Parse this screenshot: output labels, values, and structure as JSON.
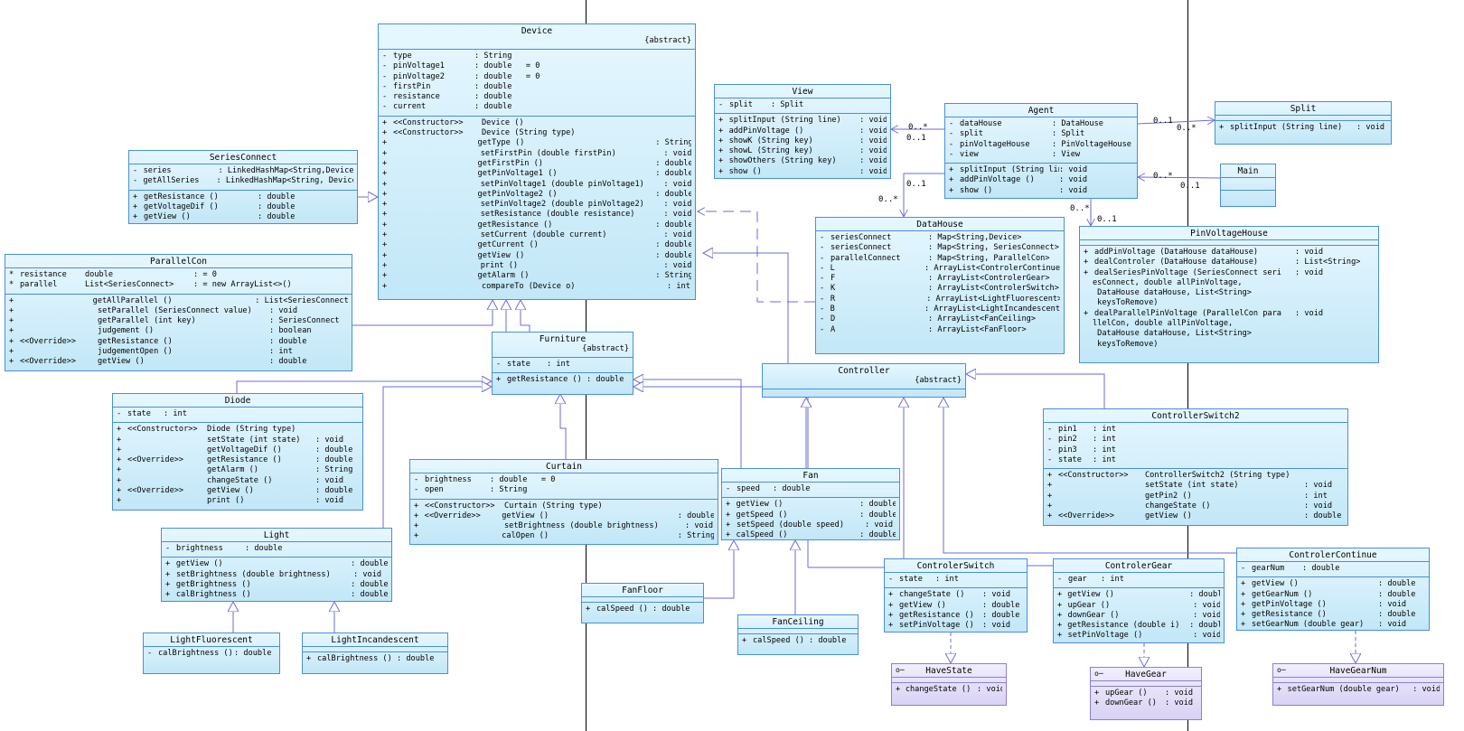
{
  "multiplicities": [
    "0..*",
    "0..1",
    "0..1",
    "0..*",
    "0..1",
    "0..*",
    "0..*",
    "0..1",
    "0..*",
    "0..1"
  ],
  "classes": {
    "device": {
      "name": "Device",
      "stereotype": "{abstract}",
      "attrs": [
        [
          "-",
          "type",
          "",
          "String"
        ],
        [
          "-",
          "pinVoltage1",
          "",
          "double   = 0"
        ],
        [
          "-",
          "pinVoltage2",
          "",
          "double   = 0"
        ],
        [
          "-",
          "firstPin",
          "",
          "double"
        ],
        [
          "-",
          "resistance",
          "",
          "double"
        ],
        [
          "-",
          "current",
          "",
          "double"
        ]
      ],
      "ops": [
        [
          "+",
          "<<Constructor>>",
          "Device ()",
          ""
        ],
        [
          "+",
          "<<Constructor>>",
          "Device (String type)",
          ""
        ],
        [
          "+",
          "",
          "getType ()",
          "String"
        ],
        [
          "+",
          "",
          "setFirstPin (double firstPin)",
          "void"
        ],
        [
          "+",
          "",
          "getFirstPin ()",
          "double"
        ],
        [
          "+",
          "",
          "getPinVoltage1 ()",
          "double"
        ],
        [
          "+",
          "",
          "setPinVoltage1 (double pinVoltage1)",
          "void"
        ],
        [
          "+",
          "",
          "getPinVoltage2 ()",
          "double"
        ],
        [
          "+",
          "",
          "setPinVoltage2 (double pinVoltage2)",
          "void"
        ],
        [
          "+",
          "",
          "setResistance (double resistance)",
          "void"
        ],
        [
          "+",
          "",
          "getResistance ()",
          "double"
        ],
        [
          "+",
          "",
          "setCurrent (double current)",
          "void"
        ],
        [
          "+",
          "",
          "getCurrent ()",
          "double"
        ],
        [
          "+",
          "",
          "getView ()",
          "double"
        ],
        [
          "+",
          "",
          "print ()",
          "void"
        ],
        [
          "+",
          "",
          "getAlarm ()",
          "String"
        ],
        [
          "+",
          "",
          "compareTo (Device o)",
          "int"
        ]
      ]
    },
    "seriesConnect": {
      "name": "SeriesConnect",
      "attrs": [
        [
          "-",
          "series",
          "",
          "LinkedHashMap<String,Device>"
        ],
        [
          "-",
          "getAllSeries",
          "",
          "LinkedHashMap<String, Device>"
        ]
      ],
      "ops": [
        [
          "+",
          "",
          "getResistance ()",
          "double"
        ],
        [
          "+",
          "",
          "getVoltageDif ()",
          "double"
        ],
        [
          "+",
          "",
          "getView ()",
          "double"
        ]
      ]
    },
    "parallelCon": {
      "name": "ParallelCon",
      "attrs": [
        [
          "*",
          "resistance",
          "double",
          "= 0"
        ],
        [
          "*",
          "parallel",
          "List<SeriesConnect>",
          "= new ArrayList<>()"
        ]
      ],
      "ops": [
        [
          "+",
          "",
          "getAllParallel ()",
          "List<SeriesConnect>"
        ],
        [
          "+",
          "",
          "setParallel (SeriesConnect value)",
          "void"
        ],
        [
          "+",
          "",
          "getParallel (int key)",
          "SeriesConnect"
        ],
        [
          "+",
          "",
          "judgement ()",
          "boolean"
        ],
        [
          "+",
          "<<Override>>",
          "getResistance ()",
          "double"
        ],
        [
          "+",
          "",
          "judgementOpen ()",
          "int"
        ],
        [
          "+",
          "<<Override>>",
          "getView ()",
          "double"
        ]
      ]
    },
    "view": {
      "name": "View",
      "attrs": [
        [
          "-",
          "split",
          "",
          "Split"
        ]
      ],
      "ops": [
        [
          "+",
          "",
          "splitInput (String line)",
          "void"
        ],
        [
          "+",
          "",
          "addPinVoltage ()",
          "void"
        ],
        [
          "+",
          "",
          "showK (String key)",
          "void"
        ],
        [
          "+",
          "",
          "showL (String key)",
          "void"
        ],
        [
          "+",
          "",
          "showOthers (String key)",
          "void"
        ],
        [
          "+",
          "",
          "show ()",
          "void"
        ]
      ]
    },
    "agent": {
      "name": "Agent",
      "attrs": [
        [
          "-",
          "dataHouse",
          "",
          "DataHouse"
        ],
        [
          "-",
          "split",
          "",
          "Split"
        ],
        [
          "-",
          "pinVoltageHouse",
          "",
          "PinVoltageHouse"
        ],
        [
          "-",
          "view",
          "",
          "View"
        ]
      ],
      "ops": [
        [
          "+",
          "",
          "splitInput (String line)",
          "void"
        ],
        [
          "+",
          "",
          "addPinVoltage ()",
          "void"
        ],
        [
          "+",
          "",
          "show ()",
          "void"
        ]
      ]
    },
    "split": {
      "name": "Split",
      "attrs": [],
      "ops": [
        [
          "+",
          "",
          "splitInput (String line)",
          "void"
        ]
      ]
    },
    "main": {
      "name": "Main"
    },
    "dataHouse": {
      "name": "DataHouse",
      "attrs": [
        [
          "-",
          "seriesConnect",
          "",
          "Map<String,Device>"
        ],
        [
          "-",
          "seriesConnect",
          "",
          "Map<String, SeriesConnect>"
        ],
        [
          "-",
          "parallelConnect",
          "",
          "Map<String, ParallelCon>"
        ],
        [
          "-",
          "L",
          "",
          "ArrayList<ControlerContinue>"
        ],
        [
          "-",
          "F",
          "",
          "ArrayList<ControlerGear>"
        ],
        [
          "-",
          "K",
          "",
          "ArrayList<ControlerSwitch>"
        ],
        [
          "-",
          "R",
          "",
          "ArrayList<LightFluorescent>"
        ],
        [
          "-",
          "B",
          "",
          "ArrayList<LightIncandescent>"
        ],
        [
          "-",
          "D",
          "",
          "ArrayList<FanCeiling>"
        ],
        [
          "-",
          "A",
          "",
          "ArrayList<FanFloor>"
        ]
      ]
    },
    "pinVoltageHouse": {
      "name": "PinVoltageHouse",
      "ops": [
        [
          "+",
          "addPinVoltage (DataHouse dataHouse)",
          "void"
        ],
        [
          "+",
          "dealControler (DataHouse dataHouse)",
          "List<String>"
        ],
        [
          "+",
          "dealSeriesPinVoltage (SeriesConnect seri",
          "void"
        ],
        [
          "+",
          "dealParallelPinVoltage (ParallelCon para",
          "void"
        ]
      ],
      "wrap1": [
        "esConnect, double allPinVoltage,",
        " DataHouse dataHouse, List<String>",
        " keysToRemove)"
      ],
      "wrap2": [
        "llelCon, double allPinVoltage,",
        " DataHouse dataHouse, List<String>",
        " keysToRemove)"
      ]
    },
    "furniture": {
      "name": "Furniture",
      "stereotype": "{abstract}",
      "attrs": [
        [
          "-",
          "state",
          "",
          "int"
        ]
      ],
      "ops": [
        [
          "+",
          "",
          "getResistance ()",
          "double"
        ]
      ]
    },
    "controller": {
      "name": "Controller",
      "stereotype": "{abstract}"
    },
    "controllerSwitch2": {
      "name": "ControllerSwitch2",
      "attrs": [
        [
          "-",
          "pin1",
          "",
          "int"
        ],
        [
          "-",
          "pin2",
          "",
          "int"
        ],
        [
          "-",
          "pin3",
          "",
          "int"
        ],
        [
          "-",
          "state",
          "",
          "int"
        ]
      ],
      "ops": [
        [
          "+",
          "<<Constructor>>",
          "ControllerSwitch2 (String type)",
          ""
        ],
        [
          "+",
          "",
          "setState (int state)",
          "void"
        ],
        [
          "+",
          "",
          "getPin2 ()",
          "int"
        ],
        [
          "+",
          "",
          "changeState ()",
          "void"
        ],
        [
          "+",
          "<<Override>>",
          "getView ()",
          "double"
        ]
      ]
    },
    "diode": {
      "name": "Diode",
      "attrs": [
        [
          "-",
          "state",
          "",
          "int"
        ]
      ],
      "ops": [
        [
          "+",
          "<<Constructor>>",
          "Diode (String type)",
          ""
        ],
        [
          "+",
          "",
          "setState (int state)",
          "void"
        ],
        [
          "+",
          "",
          "getVoltageDif ()",
          "double"
        ],
        [
          "+",
          "<<Override>>",
          "getResistance ()",
          "double"
        ],
        [
          "+",
          "",
          "getAlarm ()",
          "String"
        ],
        [
          "+",
          "",
          "changeState ()",
          "void"
        ],
        [
          "+",
          "<<Override>>",
          "getView ()",
          "double"
        ],
        [
          "+",
          "",
          "print ()",
          "void"
        ]
      ]
    },
    "curtain": {
      "name": "Curtain",
      "attrs": [
        [
          "-",
          "brightness",
          "",
          "double   = 0"
        ],
        [
          "-",
          "open",
          "",
          "String"
        ]
      ],
      "ops": [
        [
          "+",
          "<<Constructor>>",
          "Curtain (String type)",
          ""
        ],
        [
          "+",
          "<<Override>>",
          "getView ()",
          "double"
        ],
        [
          "+",
          "",
          "setBrightness (double brightness)",
          "void"
        ],
        [
          "+",
          "",
          "calOpen ()",
          "String"
        ]
      ]
    },
    "fan": {
      "name": "Fan",
      "attrs": [
        [
          "-",
          "speed",
          "",
          "double"
        ]
      ],
      "ops": [
        [
          "+",
          "",
          "getView ()",
          "double"
        ],
        [
          "+",
          "",
          "getSpeed ()",
          "double"
        ],
        [
          "+",
          "",
          "setSpeed (double speed)",
          "void"
        ],
        [
          "+",
          "",
          "calSpeed ()",
          "double"
        ]
      ]
    },
    "light": {
      "name": "Light",
      "attrs": [
        [
          "-",
          "brightness",
          "",
          "double"
        ]
      ],
      "ops": [
        [
          "+",
          "",
          "getView ()",
          "double"
        ],
        [
          "+",
          "",
          "setBrightness (double brightness)",
          "void"
        ],
        [
          "+",
          "",
          "getBrightness ()",
          "double"
        ],
        [
          "+",
          "",
          "calBrightness ()",
          "double"
        ]
      ]
    },
    "lightFluorescent": {
      "name": "LightFluorescent",
      "attrs": [
        [
          "-",
          "calBrightness ()",
          "",
          "double"
        ]
      ]
    },
    "lightIncandescent": {
      "name": "LightIncandescent",
      "ops": [
        [
          "+",
          "calBrightness ()",
          "",
          "double"
        ]
      ]
    },
    "fanFloor": {
      "name": "FanFloor",
      "ops": [
        [
          "+",
          "calSpeed ()",
          "",
          "double"
        ]
      ]
    },
    "fanCeiling": {
      "name": "FanCeiling",
      "ops": [
        [
          "+",
          "calSpeed ()",
          "",
          "double"
        ]
      ]
    },
    "controlerSwitch": {
      "name": "ControlerSwitch",
      "attrs": [
        [
          "-",
          "state",
          "",
          "int"
        ]
      ],
      "ops": [
        [
          "+",
          "changeState ()",
          "",
          "void"
        ],
        [
          "+",
          "getView ()",
          "",
          "double"
        ],
        [
          "+",
          "getResistance ()",
          "",
          "double"
        ],
        [
          "+",
          "setPinVoltage ()",
          "",
          "void"
        ]
      ]
    },
    "controlerGear": {
      "name": "ControlerGear",
      "attrs": [
        [
          "-",
          "gear",
          "",
          "int"
        ]
      ],
      "ops": [
        [
          "+",
          "getView ()",
          "",
          "doubl"
        ],
        [
          "+",
          "upGear ()",
          "",
          "void"
        ],
        [
          "+",
          "downGear ()",
          "",
          "void"
        ],
        [
          "+",
          "getResistance (double i)",
          "",
          "doubl"
        ],
        [
          "+",
          "setPinVoltage ()",
          "",
          "void"
        ]
      ]
    },
    "controlerContinue": {
      "name": "ControlerContinue",
      "attrs": [
        [
          "-",
          "gearNum",
          "",
          "double"
        ]
      ],
      "ops": [
        [
          "+",
          "getView ()",
          "",
          "double"
        ],
        [
          "+",
          "getGearNum ()",
          "",
          "double"
        ],
        [
          "+",
          "getPinVoltage ()",
          "",
          "void"
        ],
        [
          "+",
          "getResistance ()",
          "",
          "double"
        ],
        [
          "+",
          "setGearNum (double gear)",
          "",
          "void"
        ]
      ]
    },
    "haveState": {
      "name": "HaveState",
      "ops": [
        [
          "+",
          "changeState ()",
          "",
          "void"
        ]
      ]
    },
    "haveGear": {
      "name": "HaveGear",
      "ops": [
        [
          "+",
          "upGear ()",
          "",
          "void"
        ],
        [
          "+",
          "downGear ()",
          "",
          "void"
        ]
      ]
    },
    "haveGearNum": {
      "name": "HaveGearNum",
      "ops": [
        [
          "+",
          "setGearNum (double gear)",
          "",
          "void"
        ]
      ]
    }
  }
}
